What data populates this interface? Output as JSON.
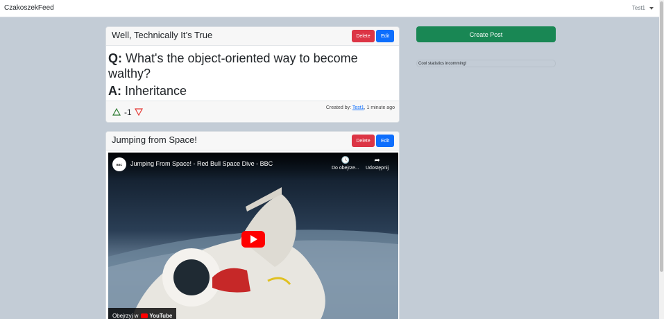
{
  "navbar": {
    "brand": "CzakoszekFeed",
    "user": "Test1"
  },
  "posts": [
    {
      "title": "Well, Technically It’s True",
      "delete_label": "Delete",
      "edit_label": "Edit",
      "q_prefix": "Q:",
      "question": " What's the object-oriented way to become walthy?",
      "a_prefix": "A:",
      "answer": " Inheritance",
      "votes": "-1",
      "created_prefix": "Created by: ",
      "author": "Test1",
      "created_suffix": ", 1 minute ago"
    },
    {
      "title": "Jumping from Space!",
      "delete_label": "Delete",
      "edit_label": "Edit",
      "video": {
        "channel_logo": "BBC",
        "title": "Jumping From Space! - Red Bull Space Dive - BBC",
        "watch_later": "Do obejrze...",
        "share": "Udostępnij",
        "watch_on": "Obejrzyj w",
        "youtube": "YouTube"
      }
    }
  ],
  "sidebar": {
    "create_post": "Create Post",
    "stats": "Cool statistics incomming!"
  },
  "colors": {
    "delete": "#dc3545",
    "edit": "#0d6efd",
    "create": "#198754",
    "upvote": "#2e7d32",
    "downvote": "#e53935"
  }
}
